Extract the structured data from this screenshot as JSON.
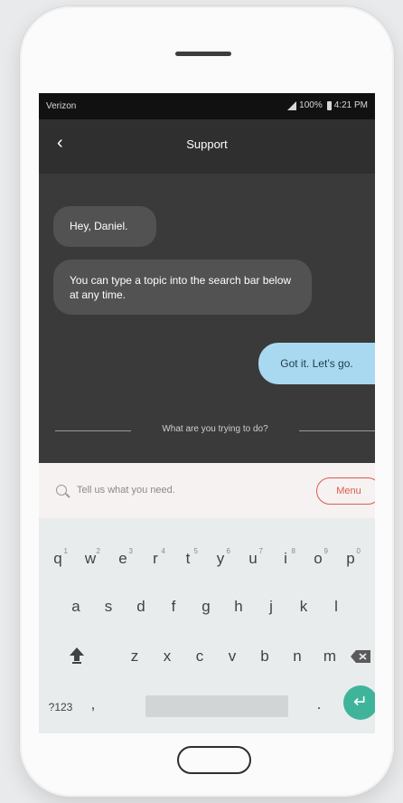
{
  "status_bar": {
    "carrier": "Verizon",
    "battery": "100%",
    "time": "4:21 PM"
  },
  "header": {
    "title": "Support",
    "back_icon": "chevron-left-icon"
  },
  "chat": {
    "messages": [
      {
        "from": "bot",
        "text": "Hey, Daniel."
      },
      {
        "from": "bot",
        "text": "You can type a topic into the search bar below at any time."
      },
      {
        "from": "user",
        "text": "Got it. Let’s go."
      }
    ],
    "divider_text": "What are you trying to do?",
    "colors": {
      "bot_bubble": "#525252",
      "user_bubble": "#a9d9f1"
    }
  },
  "search": {
    "placeholder": "Tell us what you need.",
    "menu_label": "Menu",
    "accent": "#e0594f"
  },
  "keyboard": {
    "row1": [
      "q",
      "w",
      "e",
      "r",
      "t",
      "y",
      "u",
      "i",
      "o",
      "p"
    ],
    "row1_hints": [
      "1",
      "2",
      "3",
      "4",
      "5",
      "6",
      "7",
      "8",
      "9",
      "0"
    ],
    "row2": [
      "a",
      "s",
      "d",
      "f",
      "g",
      "h",
      "j",
      "k",
      "l"
    ],
    "row3": [
      "z",
      "x",
      "c",
      "v",
      "b",
      "n",
      "m"
    ],
    "bottom": {
      "symbols": "?123",
      "comma": ",",
      "period": "."
    },
    "enter_color": "#3fb49b"
  }
}
